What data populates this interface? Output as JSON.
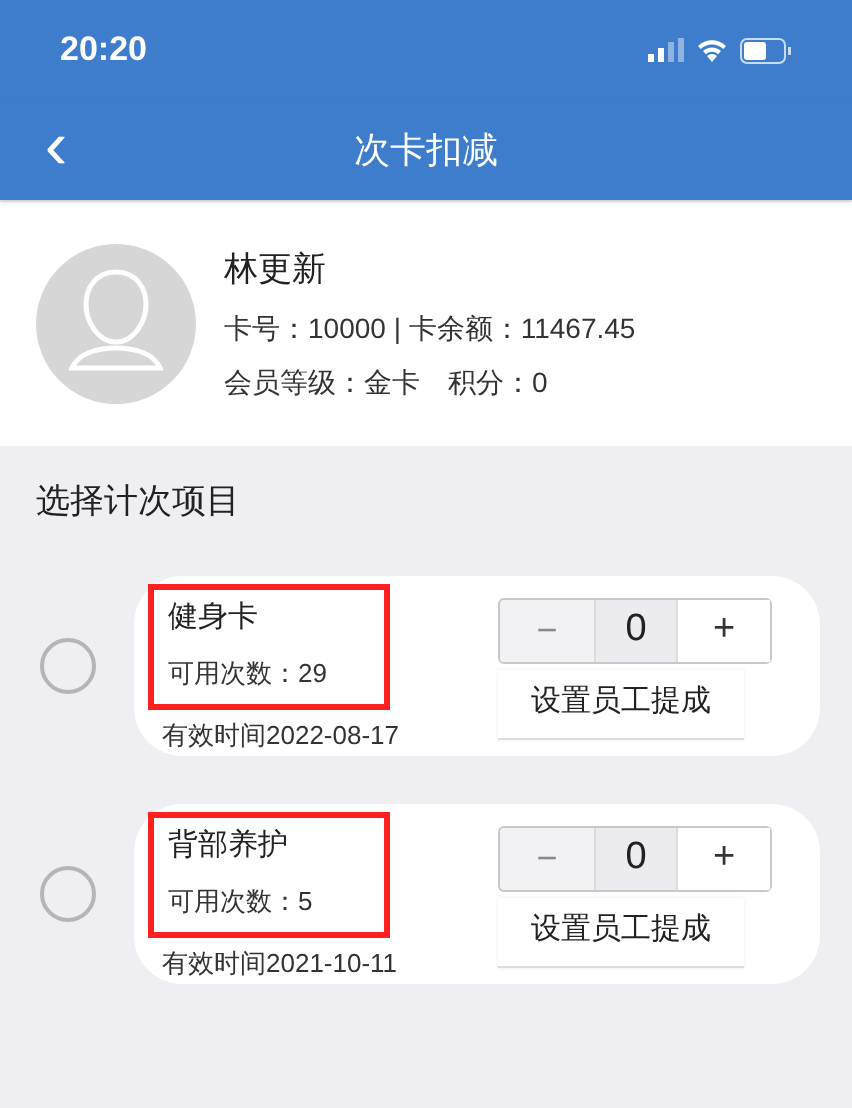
{
  "status_bar": {
    "time": "20:20"
  },
  "nav": {
    "back": "‹",
    "title": "次卡扣减"
  },
  "member": {
    "name": "林更新",
    "card_line": "卡号：10000 | 卡余额：11467.45",
    "level_line": "会员等级：金卡　积分：0"
  },
  "section_title": "选择计次项目",
  "items": [
    {
      "name": "健身卡",
      "remaining": "可用次数：29",
      "valid": "有效时间2022-08-17",
      "selected": false,
      "highlighted": true,
      "minus": "−",
      "count": "0",
      "plus": "+",
      "commission": "设置员工提成"
    },
    {
      "name": "背部养护",
      "remaining": "可用次数：5",
      "valid": "有效时间2021-10-11",
      "selected": false,
      "highlighted": true,
      "minus": "−",
      "count": "0",
      "plus": "+",
      "commission": "设置员工提成"
    }
  ]
}
